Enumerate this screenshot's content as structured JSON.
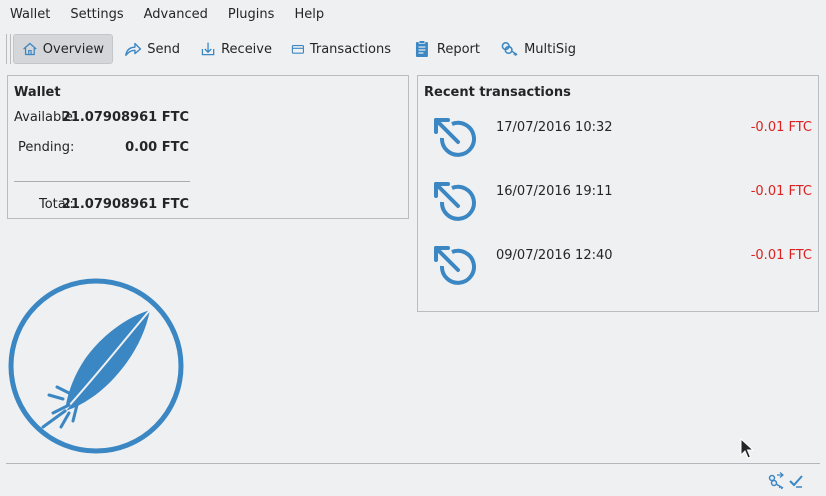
{
  "menu": {
    "items": [
      "Wallet",
      "Settings",
      "Advanced",
      "Plugins",
      "Help"
    ]
  },
  "toolbar": {
    "overview": "Overview",
    "send": "Send",
    "receive": "Receive",
    "transactions": "Transactions",
    "report": "Report",
    "multisig": "MultiSig"
  },
  "wallet": {
    "title": "Wallet",
    "available_label": "Available:",
    "available_value": "21.07908961 FTC",
    "pending_label": "Pending:",
    "pending_value": "0.00 FTC",
    "total_label": "Total:",
    "total_value": "21.07908961 FTC"
  },
  "recent": {
    "title": "Recent transactions",
    "items": [
      {
        "date": "17/07/2016 10:32",
        "amount": "-0.01 FTC"
      },
      {
        "date": "16/07/2016 19:11",
        "amount": "-0.01 FTC"
      },
      {
        "date": "09/07/2016 12:40",
        "amount": "-0.01 FTC"
      }
    ]
  },
  "colors": {
    "accent": "#3b87c4",
    "negative": "#da2020",
    "background": "#eff0f1"
  },
  "icons": {
    "logo": "feather-logo",
    "status_network": "network-icon",
    "status_synced": "checkmark-icon"
  }
}
